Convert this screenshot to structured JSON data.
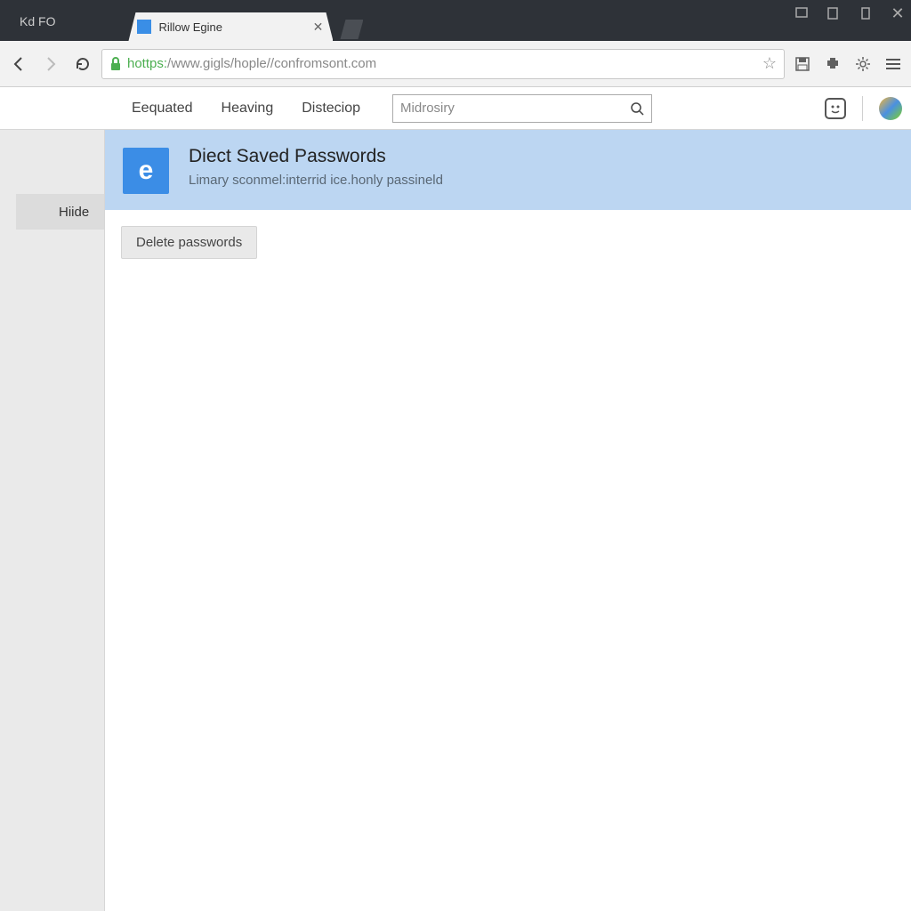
{
  "title_bar": {
    "prefix": "Kd FO"
  },
  "tab": {
    "title": "Rillow Egine"
  },
  "url": {
    "protocol": "hottps:",
    "rest": "/www.gigls/hople//confromsont.com"
  },
  "page_nav": {
    "items": [
      "Eequated",
      "Heaving",
      "Disteciop"
    ],
    "search_value": "Midrosiry"
  },
  "sidebar": {
    "item": "Hiide"
  },
  "banner": {
    "icon_letter": "e",
    "title": "Diect Saved Passwords",
    "subtitle": "Limary sconmel:interrid ice.honly passineld"
  },
  "action": {
    "delete_label": "Delete passwords"
  }
}
